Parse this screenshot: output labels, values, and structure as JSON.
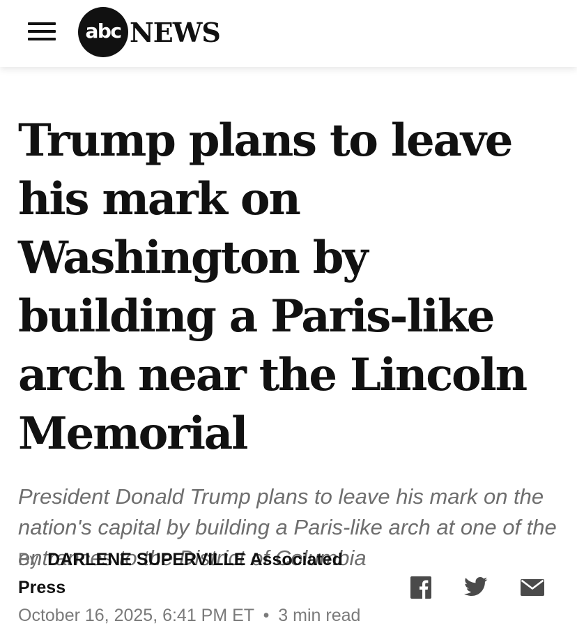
{
  "header": {
    "menu_icon": "hamburger-menu-icon",
    "logo": {
      "abc_text": "abc",
      "news_text": "NEWS"
    }
  },
  "article": {
    "headline": "Trump plans to leave his mark on Washington by building a Paris-like arch near the Lincoln Memorial",
    "summary": "President Donald Trump plans to leave his mark on the nation's capital by building a Paris-like arch at one of the entrances to the District of Columbia",
    "byline": {
      "by_label": "By",
      "author": "DARLENE SUPERVILLE Associated Press"
    },
    "date": "October 16, 2025, 6:41 PM ET",
    "separator": "•",
    "read_time": "3 min read"
  },
  "share": {
    "icons": [
      "facebook-icon",
      "twitter-icon",
      "email-icon"
    ]
  },
  "colors": {
    "text": "#111111",
    "muted": "#6e6e6e",
    "icon": "#4a4a4a"
  }
}
